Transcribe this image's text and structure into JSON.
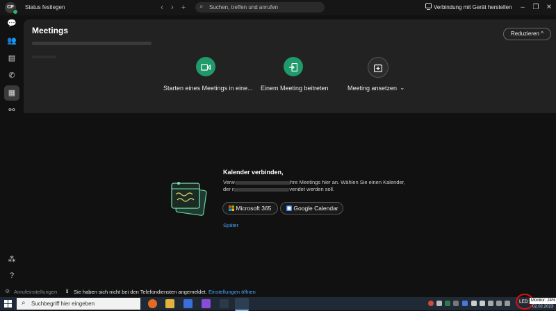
{
  "header": {
    "avatar_initials": "CP",
    "status": "Status festlegen",
    "search_placeholder": "Suchen, treffen und anrufen",
    "connect_label": "Verbindung mit Gerät herstellen"
  },
  "sidebar": {
    "items": [
      {
        "icon": "chat-icon"
      },
      {
        "icon": "teams-icon"
      },
      {
        "icon": "contacts-icon"
      },
      {
        "icon": "phone-icon"
      },
      {
        "icon": "calendar-icon",
        "active": true
      },
      {
        "icon": "workflow-icon"
      }
    ],
    "bottom": [
      {
        "icon": "apps-icon"
      },
      {
        "icon": "help-icon"
      }
    ]
  },
  "meetings": {
    "title": "Meetings",
    "reduce_label": "Reduzieren",
    "actions": [
      {
        "label": "Starten eines Meetings in eine...",
        "icon": "video-icon",
        "color": "#1f9a6b"
      },
      {
        "label": "Einem Meeting beitreten",
        "icon": "join-icon",
        "color": "#1f9a6b"
      },
      {
        "label": "Meeting ansetzen",
        "icon": "calendar-add-icon",
        "color": "#2c2c2c"
      }
    ]
  },
  "calendar_connect": {
    "title": "Kalender verbinden,",
    "line1_start": "Verw",
    "line1_end": "hre Meetings hier an. Wählen Sie einen Kalender,",
    "line2_start": "der r",
    "line2_end": "vendet werden soll.",
    "ms365_label": "Microsoft 365",
    "google_label": "Google Calendar",
    "later_label": "Später"
  },
  "status_bar": {
    "call_settings": "Anrufeinstellungen",
    "notice": "Sie haben sich nicht bei den Telefondiensten angemeldet.",
    "notice_link": "Einstellungen öffnen"
  },
  "taskbar": {
    "search_placeholder": "Suchbegriff hier eingeben",
    "led_label": "LED B",
    "monitor_label": "Monitor: 24%",
    "date": "02.02.2023"
  },
  "colors": {
    "accent": "#1f9a6b",
    "link": "#4aa3ff",
    "highlight_ring": "#e01010"
  }
}
